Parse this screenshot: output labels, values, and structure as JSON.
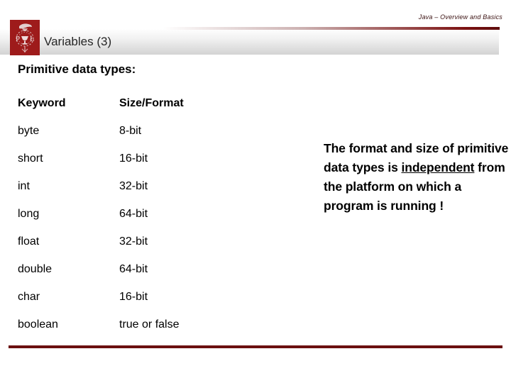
{
  "header": {
    "note": "Java – Overview and Basics",
    "title": "Variables (3)",
    "logo_icon": "university-crest-icon",
    "logo_initials": "P Ł"
  },
  "main": {
    "section_heading": "Primitive data types:",
    "table": {
      "columns": [
        "Keyword",
        "Size/Format"
      ],
      "rows": [
        {
          "keyword": "byte",
          "format": "8-bit"
        },
        {
          "keyword": "short",
          "format": "16-bit"
        },
        {
          "keyword": "int",
          "format": "32-bit"
        },
        {
          "keyword": "long",
          "format": "64-bit"
        },
        {
          "keyword": "float",
          "format": "32-bit"
        },
        {
          "keyword": "double",
          "format": "64-bit"
        },
        {
          "keyword": "char",
          "format": "16-bit"
        },
        {
          "keyword": "boolean",
          "format": "true or false"
        }
      ]
    },
    "callout": {
      "part1": "The format and size of primitive data types is ",
      "emphasis": "independent",
      "part2": " from the platform on which a program is running !"
    }
  },
  "colors": {
    "accent_dark_red": "#6b0f0f",
    "logo_red": "#9e1b1b",
    "rule_red": "#7c1212",
    "title_text": "#262626",
    "body_text": "#000000",
    "title_bar_top": "#fdfdfd",
    "title_bar_bottom": "#d3d3d3"
  }
}
